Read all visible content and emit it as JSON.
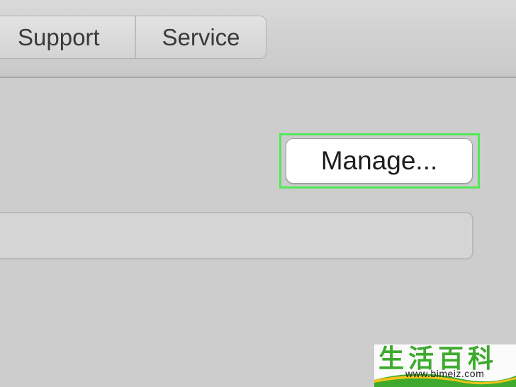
{
  "toolbar": {
    "tabs": [
      {
        "label": "Support"
      },
      {
        "label": "Service"
      }
    ]
  },
  "main": {
    "manage_button_label": "Manage...",
    "text_field_value": ""
  },
  "watermark": {
    "logo_text": "生活百科",
    "url": "www.bimeiz.com"
  },
  "colors": {
    "focus_ring": "#52e85a",
    "background": "#cdcdcd",
    "watermark_green": "#3daa2e",
    "watermark_yellow": "#f0c419"
  }
}
